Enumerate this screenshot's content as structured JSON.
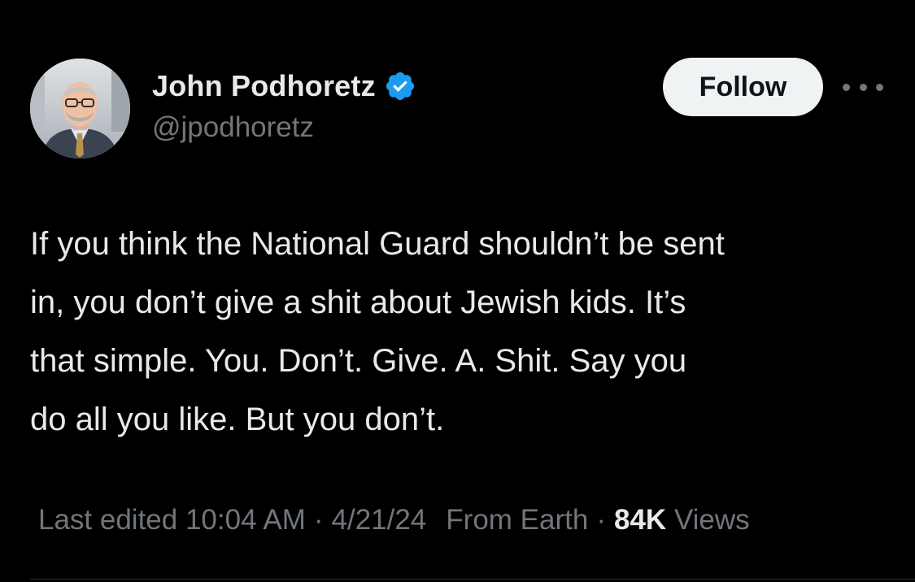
{
  "author": {
    "display_name": "John Podhoretz",
    "handle": "@jpodhoretz",
    "verified": true
  },
  "actions": {
    "follow_label": "Follow",
    "more_icon": "more-horizontal-icon"
  },
  "tweet": {
    "lines": [
      "If you think the National Guard shouldn’t be sent",
      "in, you don’t give a shit about Jewish kids. It’s",
      "that simple. You. Don’t. Give. A. Shit. Say you",
      "do all you like. But you don’t."
    ]
  },
  "meta": {
    "edited_label": "Last edited 10:04 AM",
    "separator": "·",
    "date": "4/21/24",
    "location": "From Earth",
    "views_count": "84K",
    "views_label": "Views"
  },
  "colors": {
    "background": "#000000",
    "text_primary": "#e7e9ea",
    "text_secondary": "#71767b",
    "verified_blue": "#1d9bf0",
    "follow_bg": "#eff3f4"
  }
}
